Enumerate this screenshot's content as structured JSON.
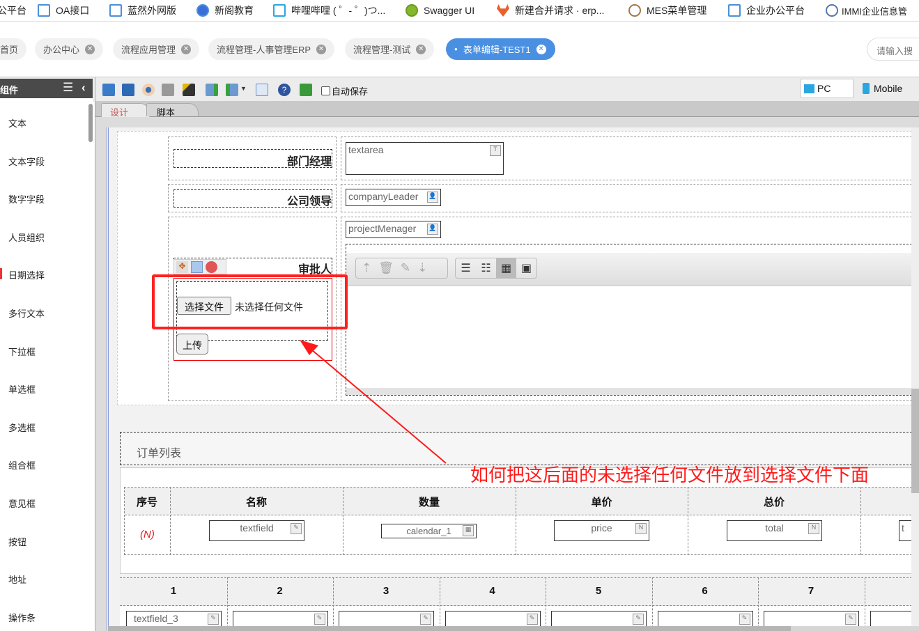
{
  "bookmarks": [
    {
      "label": "公平台"
    },
    {
      "label": "OA接口"
    },
    {
      "label": "蓝然外网版"
    },
    {
      "label": "新阁教育"
    },
    {
      "label": "哔哩哔哩 ( ゜- ゜)つ..."
    },
    {
      "label": "Swagger UI"
    },
    {
      "label": "新建合并请求 · erp..."
    },
    {
      "label": "MES菜单管理"
    },
    {
      "label": "企业办公平台"
    },
    {
      "label": "IMMI企业信息管"
    }
  ],
  "tabs": [
    {
      "label": "首页"
    },
    {
      "label": "办公中心"
    },
    {
      "label": "流程应用管理"
    },
    {
      "label": "流程管理-人事管理ERP"
    },
    {
      "label": "流程管理-测试"
    },
    {
      "label": "表单编辑-TEST1",
      "active": true
    }
  ],
  "search": {
    "placeholder": "请输入搜"
  },
  "sidebar": {
    "title": "组件",
    "items": [
      "文本",
      "文本字段",
      "数字字段",
      "人员组织",
      "日期选择",
      "多行文本",
      "下拉框",
      "单选框",
      "多选框",
      "组合框",
      "意见框",
      "按钮",
      "地址",
      "操作条"
    ]
  },
  "toolbar": {
    "autosave_label": "自动保存",
    "autosave_checked": false,
    "pc_label": "PC",
    "mobile_label": "Mobile"
  },
  "editor_tabs": [
    {
      "label": "设计",
      "active": true
    },
    {
      "label": "脚本"
    }
  ],
  "form": {
    "dept_manager_label": "部门经理",
    "textarea_value": "textarea",
    "company_leader_label": "公司领导",
    "company_leader_value": "companyLeader",
    "approver_label": "审批人",
    "project_manager_value": "projectMenager",
    "choose_file_label": "选择文件",
    "no_file_label": "未选择任何文件",
    "upload_label": "上传"
  },
  "order": {
    "title": "订单列表",
    "headers": [
      "序号",
      "名称",
      "数量",
      "单价",
      "总价"
    ],
    "row": {
      "index": "(N)",
      "name": "textfield",
      "qty": "calendar_1",
      "price": "price",
      "total": "total",
      "extra": "t"
    },
    "grid_headers": [
      "1",
      "2",
      "3",
      "4",
      "5",
      "6",
      "7"
    ],
    "grid_first": "textfield_3"
  },
  "annotation": {
    "text": "如何把这后面的未选择任何文件放到选择文件下面",
    "color": "#ff1a1a"
  }
}
